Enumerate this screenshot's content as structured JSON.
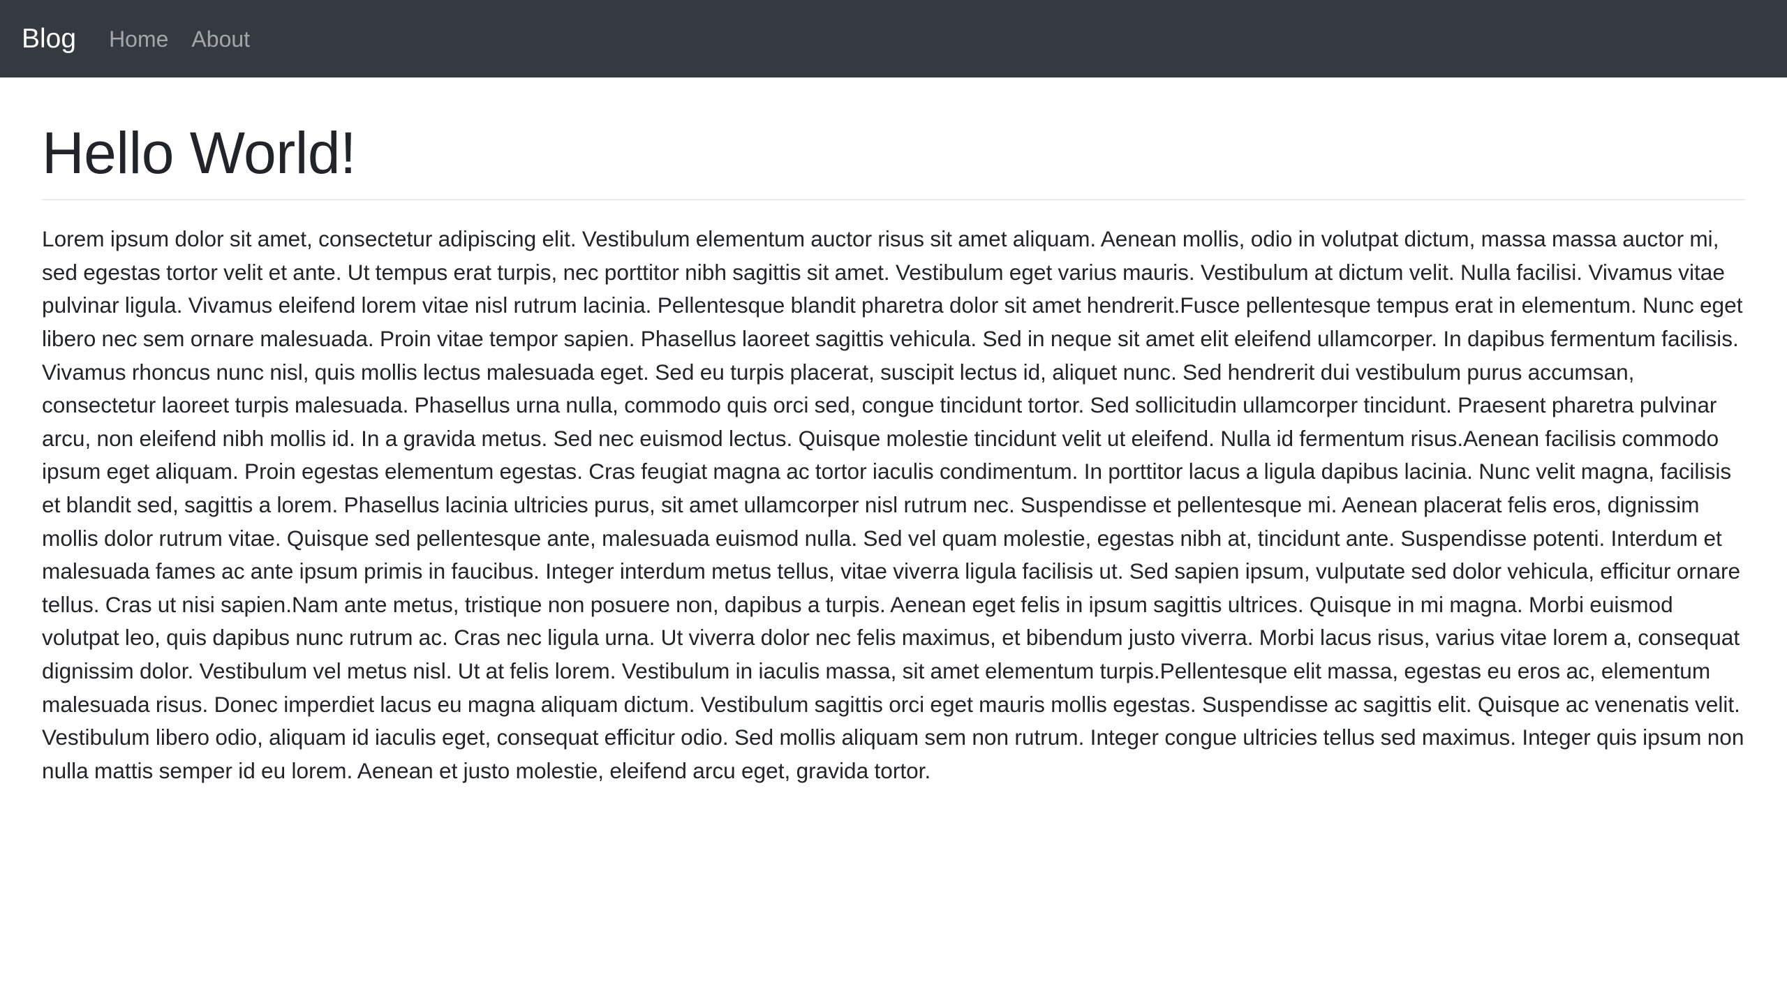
{
  "navbar": {
    "brand": "Blog",
    "links": [
      {
        "label": "Home"
      },
      {
        "label": "About"
      }
    ],
    "background": "#343a40"
  },
  "main": {
    "title": "Hello World!",
    "body": "Lorem ipsum dolor sit amet, consectetur adipiscing elit. Vestibulum elementum auctor risus sit amet aliquam. Aenean mollis, odio in volutpat dictum, massa massa auctor mi, sed egestas tortor velit et ante. Ut tempus erat turpis, nec porttitor nibh sagittis sit amet. Vestibulum eget varius mauris. Vestibulum at dictum velit. Nulla facilisi. Vivamus vitae pulvinar ligula. Vivamus eleifend lorem vitae nisl rutrum lacinia. Pellentesque blandit pharetra dolor sit amet hendrerit.Fusce pellentesque tempus erat in elementum. Nunc eget libero nec sem ornare malesuada. Proin vitae tempor sapien. Phasellus laoreet sagittis vehicula. Sed in neque sit amet elit eleifend ullamcorper. In dapibus fermentum facilisis. Vivamus rhoncus nunc nisl, quis mollis lectus malesuada eget. Sed eu turpis placerat, suscipit lectus id, aliquet nunc. Sed hendrerit dui vestibulum purus accumsan, consectetur laoreet turpis malesuada. Phasellus urna nulla, commodo quis orci sed, congue tincidunt tortor. Sed sollicitudin ullamcorper tincidunt. Praesent pharetra pulvinar arcu, non eleifend nibh mollis id. In a gravida metus. Sed nec euismod lectus. Quisque molestie tincidunt velit ut eleifend. Nulla id fermentum risus.Aenean facilisis commodo ipsum eget aliquam. Proin egestas elementum egestas. Cras feugiat magna ac tortor iaculis condimentum. In porttitor lacus a ligula dapibus lacinia. Nunc velit magna, facilisis et blandit sed, sagittis a lorem. Phasellus lacinia ultricies purus, sit amet ullamcorper nisl rutrum nec. Suspendisse et pellentesque mi. Aenean placerat felis eros, dignissim mollis dolor rutrum vitae. Quisque sed pellentesque ante, malesuada euismod nulla. Sed vel quam molestie, egestas nibh at, tincidunt ante. Suspendisse potenti. Interdum et malesuada fames ac ante ipsum primis in faucibus. Integer interdum metus tellus, vitae viverra ligula facilisis ut. Sed sapien ipsum, vulputate sed dolor vehicula, efficitur ornare tellus. Cras ut nisi sapien.Nam ante metus, tristique non posuere non, dapibus a turpis. Aenean eget felis in ipsum sagittis ultrices. Quisque in mi magna. Morbi euismod volutpat leo, quis dapibus nunc rutrum ac. Cras nec ligula urna. Ut viverra dolor nec felis maximus, et bibendum justo viverra. Morbi lacus risus, varius vitae lorem a, consequat dignissim dolor. Vestibulum vel metus nisl. Ut at felis lorem. Vestibulum in iaculis massa, sit amet elementum turpis.Pellentesque elit massa, egestas eu eros ac, elementum malesuada risus. Donec imperdiet lacus eu magna aliquam dictum. Vestibulum sagittis orci eget mauris mollis egestas. Suspendisse ac sagittis elit. Quisque ac venenatis velit. Vestibulum libero odio, aliquam id iaculis eget, consequat efficitur odio. Sed mollis aliquam sem non rutrum. Integer congue ultricies tellus sed maximus. Integer quis ipsum non nulla mattis semper id eu lorem. Aenean et justo molestie, eleifend arcu eget, gravida tortor."
  }
}
